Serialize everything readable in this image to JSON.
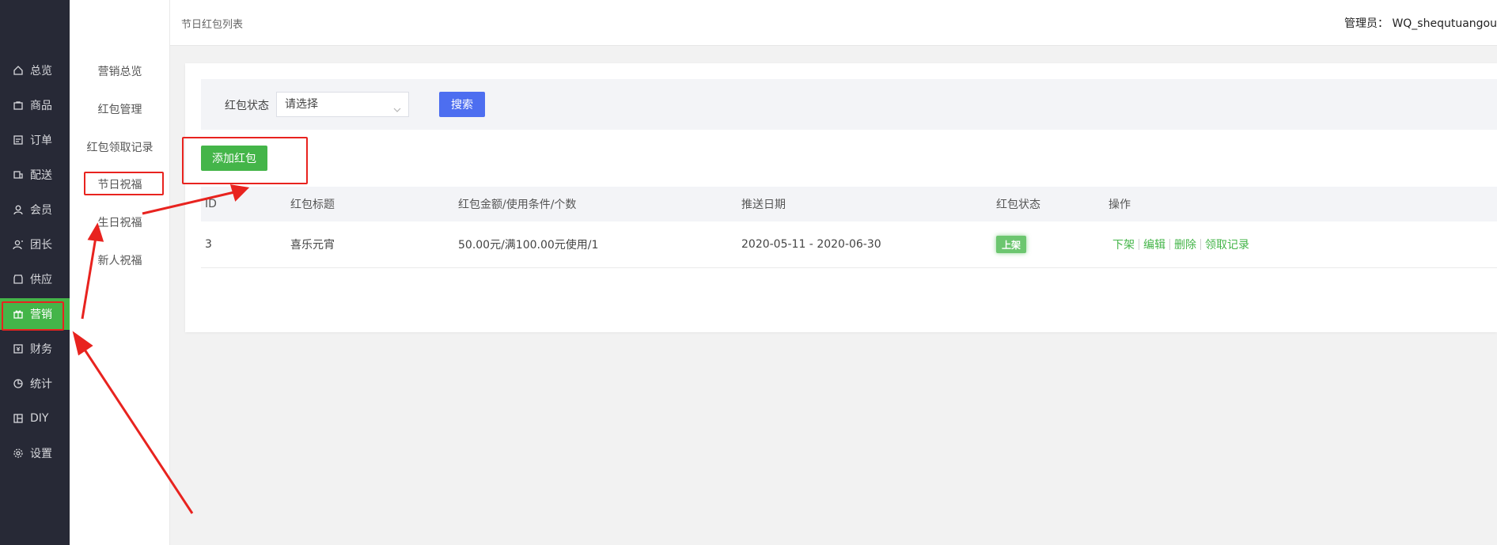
{
  "nav": {
    "items": [
      {
        "label": "总览",
        "icon": "home-icon"
      },
      {
        "label": "商品",
        "icon": "bag-icon"
      },
      {
        "label": "订单",
        "icon": "receipt-icon"
      },
      {
        "label": "配送",
        "icon": "delivery-icon"
      },
      {
        "label": "会员",
        "icon": "user-icon"
      },
      {
        "label": "团长",
        "icon": "leader-icon"
      },
      {
        "label": "供应",
        "icon": "store-icon"
      },
      {
        "label": "营销",
        "icon": "gift-icon",
        "active": true
      },
      {
        "label": "财务",
        "icon": "finance-icon"
      },
      {
        "label": "统计",
        "icon": "pie-chart-icon"
      },
      {
        "label": "DIY",
        "icon": "layout-icon"
      },
      {
        "label": "设置",
        "icon": "gear-icon"
      }
    ]
  },
  "subnav": {
    "items": [
      "营销总览",
      "红包管理",
      "红包领取记录",
      "节日祝福",
      "生日祝福",
      "新人祝福"
    ]
  },
  "header": {
    "breadcrumb": "节日红包列表",
    "admin": "管理员： WQ_shequtuangou"
  },
  "filter": {
    "label": "红包状态",
    "select_value": "请选择",
    "search_label": "搜索"
  },
  "add_button": "添加红包",
  "table": {
    "headers": [
      "ID",
      "红包标题",
      "红包金额/使用条件/个数",
      "推送日期",
      "红包状态",
      "操作"
    ],
    "rows": [
      {
        "id": "3",
        "title": "喜乐元宵",
        "amount": "50.00元/满100.00元使用/1",
        "date": "2020-05-11 - 2020-06-30",
        "status": "上架",
        "ops": [
          "下架",
          "编辑",
          "删除",
          "领取记录"
        ]
      }
    ]
  },
  "colors": {
    "accent": "#44b549",
    "nav_bg": "#272936",
    "search": "#4d6ef0",
    "annotation": "#e8231f"
  }
}
